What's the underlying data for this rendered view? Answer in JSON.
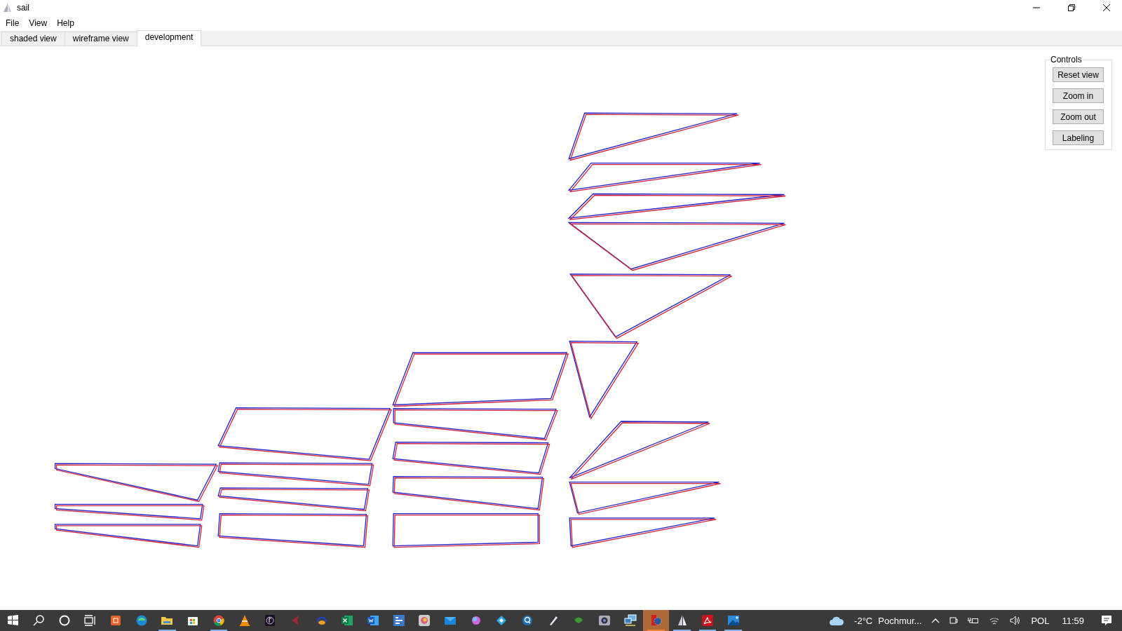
{
  "window": {
    "title": "sail"
  },
  "menu": [
    "File",
    "View",
    "Help"
  ],
  "tabs": [
    {
      "label": "shaded view",
      "selected": false
    },
    {
      "label": "wireframe view",
      "selected": false
    },
    {
      "label": "development",
      "selected": true
    }
  ],
  "controls": {
    "title": "Controls",
    "buttons": [
      "Reset view",
      "Zoom in",
      "Zoom out",
      "Labeling"
    ]
  },
  "taskbar": {
    "apps": [
      {
        "kind": "start",
        "running": false,
        "selected": false
      },
      {
        "kind": "search",
        "running": false,
        "selected": false
      },
      {
        "kind": "circle",
        "running": false,
        "selected": false
      },
      {
        "kind": "taskview",
        "running": false,
        "selected": false
      },
      {
        "kind": "office",
        "running": false,
        "selected": false
      },
      {
        "kind": "browser",
        "running": false,
        "selected": false
      },
      {
        "kind": "folder",
        "running": true,
        "selected": false
      },
      {
        "kind": "store",
        "running": false,
        "selected": false
      },
      {
        "kind": "chrome",
        "running": true,
        "selected": false
      },
      {
        "kind": "cone",
        "running": false,
        "selected": false
      },
      {
        "kind": "music",
        "running": false,
        "selected": false
      },
      {
        "kind": "tool",
        "running": false,
        "selected": false
      },
      {
        "kind": "headset",
        "running": false,
        "selected": false
      },
      {
        "kind": "sheet",
        "running": false,
        "selected": false
      },
      {
        "kind": "doc",
        "running": false,
        "selected": false
      },
      {
        "kind": "diagram",
        "running": false,
        "selected": false
      },
      {
        "kind": "paint",
        "running": false,
        "selected": false
      },
      {
        "kind": "mail",
        "running": false,
        "selected": false
      },
      {
        "kind": "ball",
        "running": false,
        "selected": false
      },
      {
        "kind": "diamond",
        "running": false,
        "selected": false
      },
      {
        "kind": "magnifier",
        "running": false,
        "selected": false
      },
      {
        "kind": "pen",
        "running": false,
        "selected": false
      },
      {
        "kind": "leaf",
        "running": false,
        "selected": false
      },
      {
        "kind": "camera",
        "running": false,
        "selected": false
      },
      {
        "kind": "network",
        "running": false,
        "selected": false
      },
      {
        "kind": "gear",
        "running": true,
        "selected": true
      },
      {
        "kind": "sail",
        "running": true,
        "selected": false
      },
      {
        "kind": "pdf",
        "running": true,
        "selected": false
      },
      {
        "kind": "image",
        "running": true,
        "selected": false
      }
    ],
    "temperature": "-2°C",
    "weather": "Pochmur...",
    "language": "POL",
    "time": "11:59"
  }
}
